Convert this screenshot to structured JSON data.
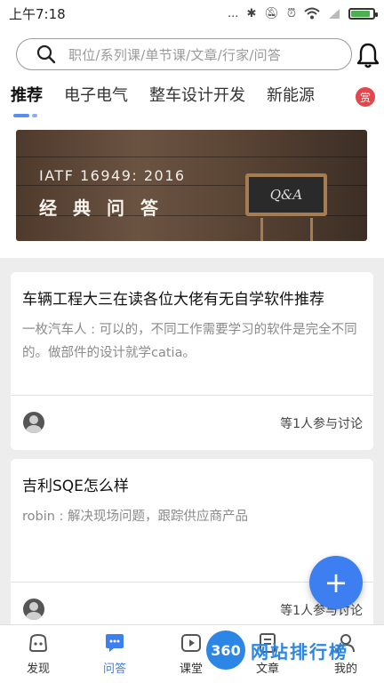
{
  "status_bar": {
    "time": "上午7:18",
    "signal": "..."
  },
  "search": {
    "placeholder": "职位/系列课/单节课/文章/行家/问答"
  },
  "tabs": [
    {
      "label": "推荐",
      "active": true
    },
    {
      "label": "电子电气"
    },
    {
      "label": "整车设计开发"
    },
    {
      "label": "新能源"
    }
  ],
  "reward_badge": "赏",
  "banner": {
    "line1": "IATF 16949: 2016",
    "line2": "经典问答",
    "board": "Q&A"
  },
  "cards": [
    {
      "title": "车辆工程大三在读各位大佬有无自学软件推荐",
      "excerpt": "一枚汽车人 : 可以的，不同工作需要学习的软件是完全不同的。做部件的设计就学catia。",
      "participants": "等1人参与讨论"
    },
    {
      "title": "吉利SQE怎么样",
      "excerpt": "robin : 解决现场问题，跟踪供应商产品",
      "participants": "等1人参与讨论"
    }
  ],
  "fab_label": "+",
  "bottom_nav": [
    {
      "label": "发现",
      "icon": "discover-icon"
    },
    {
      "label": "问答",
      "icon": "qa-chat-icon",
      "active": true
    },
    {
      "label": "课堂",
      "icon": "video-play-icon"
    },
    {
      "label": "文章",
      "icon": "article-icon"
    },
    {
      "label": "我的",
      "icon": "profile-icon"
    }
  ],
  "watermark": {
    "logo": "360",
    "text": "网站排行榜"
  },
  "colors": {
    "accent": "#3d7ef0",
    "reward": "#e2474b"
  }
}
